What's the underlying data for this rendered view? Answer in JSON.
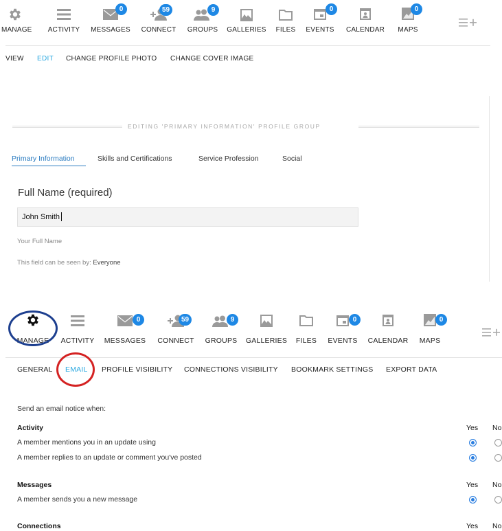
{
  "nav_top": {
    "items": [
      {
        "label": "MANAGE",
        "icon": "gear-icon"
      },
      {
        "label": "ACTIVITY",
        "icon": "activity-list-icon"
      },
      {
        "label": "MESSAGES",
        "icon": "message-icon",
        "badge": "0"
      },
      {
        "label": "CONNECT",
        "icon": "connect-icon",
        "badge": "59"
      },
      {
        "label": "GROUPS",
        "icon": "groups-icon",
        "badge": "9"
      },
      {
        "label": "GALLERIES",
        "icon": "galleries-icon"
      },
      {
        "label": "FILES",
        "icon": "folder-icon"
      },
      {
        "label": "EVENTS",
        "icon": "events-icon",
        "badge": "0"
      },
      {
        "label": "CALENDAR",
        "icon": "calendar-icon"
      },
      {
        "label": "MAPS",
        "icon": "maps-icon",
        "badge": "0"
      }
    ],
    "overflow_icon": "menu-plus-icon"
  },
  "profile_subnav": {
    "view": "VIEW",
    "edit": "EDIT",
    "change_photo": "CHANGE PROFILE PHOTO",
    "change_cover": "CHANGE COVER IMAGE"
  },
  "profile_group": {
    "title": "EDITING 'PRIMARY INFORMATION' PROFILE GROUP",
    "tabs": [
      "Primary Information",
      "Skills and Certifications",
      "Service Profession",
      "Social"
    ],
    "field_label": "Full Name (required)",
    "field_value": "John Smith",
    "field_hint": "Your Full Name",
    "visibility_prefix": "This field can be seen by: ",
    "visibility_value": "Everyone"
  },
  "nav_bottom": {
    "items": [
      {
        "label": "MANAGE",
        "icon": "gear-icon"
      },
      {
        "label": "ACTIVITY",
        "icon": "activity-list-icon"
      },
      {
        "label": "MESSAGES",
        "icon": "message-icon",
        "badge": "0"
      },
      {
        "label": "CONNECT",
        "icon": "connect-icon",
        "badge": "59"
      },
      {
        "label": "GROUPS",
        "icon": "groups-icon",
        "badge": "9"
      },
      {
        "label": "GALLERIES",
        "icon": "galleries-icon"
      },
      {
        "label": "FILES",
        "icon": "folder-icon"
      },
      {
        "label": "EVENTS",
        "icon": "events-icon",
        "badge": "0"
      },
      {
        "label": "CALENDAR",
        "icon": "calendar-icon"
      },
      {
        "label": "MAPS",
        "icon": "maps-icon",
        "badge": "0"
      }
    ]
  },
  "settings_subnav": {
    "general": "GENERAL",
    "email": "EMAIL",
    "profile_visibility": "PROFILE VISIBILITY",
    "connections_visibility": "CONNECTIONS VISIBILITY",
    "bookmark_settings": "BOOKMARK SETTINGS",
    "export_data": "EXPORT DATA"
  },
  "email_settings": {
    "intro": "Send an email notice when:",
    "yes": "Yes",
    "no": "No",
    "groups": [
      {
        "name": "Activity",
        "rows": [
          {
            "text": "A member mentions you in an update using",
            "yes": true
          },
          {
            "text": "A member replies to an update or comment you've posted",
            "yes": true
          }
        ]
      },
      {
        "name": "Messages",
        "rows": [
          {
            "text": "A member sends you a new message",
            "yes": true
          }
        ]
      },
      {
        "name": "Connections",
        "rows": []
      }
    ]
  },
  "colors": {
    "accent": "#29a8e0",
    "badge": "#1e88e5",
    "annotation_blue": "#1d3f8f",
    "annotation_red": "#d42222"
  }
}
